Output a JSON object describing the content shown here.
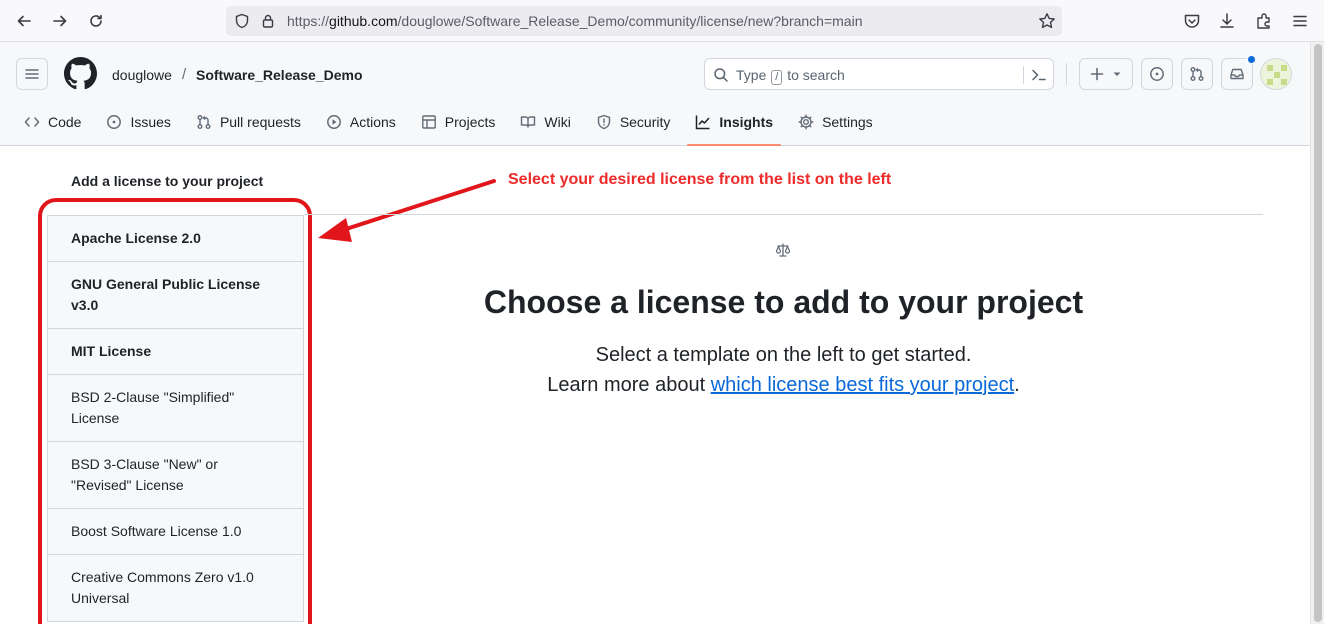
{
  "browser": {
    "url_prefix": "https://",
    "url_domain": "github.com",
    "url_path": "/douglowe/Software_Release_Demo/community/license/new?branch=main"
  },
  "repo_header": {
    "owner": "douglowe",
    "separator": "/",
    "repo_name": "Software_Release_Demo",
    "search_prefix": "Type",
    "search_key": "/",
    "search_suffix": "to search"
  },
  "tabs": [
    {
      "label": "Code",
      "icon": "code-icon"
    },
    {
      "label": "Issues",
      "icon": "issue-opened-icon"
    },
    {
      "label": "Pull requests",
      "icon": "git-pull-request-icon"
    },
    {
      "label": "Actions",
      "icon": "play-icon"
    },
    {
      "label": "Projects",
      "icon": "table-icon"
    },
    {
      "label": "Wiki",
      "icon": "book-icon"
    },
    {
      "label": "Security",
      "icon": "shield-icon"
    },
    {
      "label": "Insights",
      "icon": "graph-icon",
      "active": true
    },
    {
      "label": "Settings",
      "icon": "gear-icon"
    }
  ],
  "sidebar": {
    "title": "Add a license to your project",
    "licenses": [
      {
        "label": "Apache License 2.0"
      },
      {
        "label": "GNU General Public License v3.0"
      },
      {
        "label": "MIT License"
      },
      {
        "label": "BSD 2-Clause \"Simplified\" License"
      },
      {
        "label": "BSD 3-Clause \"New\" or \"Revised\" License"
      },
      {
        "label": "Boost Software License 1.0"
      },
      {
        "label": "Creative Commons Zero v1.0 Universal"
      }
    ]
  },
  "annotation": {
    "text": "Select your desired license from the list on the left",
    "color": "#e0161b"
  },
  "main": {
    "heading": "Choose a license to add to your project",
    "line1": "Select a template on the left to get started.",
    "line2_prefix": "Learn more about ",
    "link_text": "which license best fits your project",
    "line2_suffix": "."
  },
  "colors": {
    "accent_link": "#0969da",
    "active_tab_underline": "#fd8c73"
  }
}
